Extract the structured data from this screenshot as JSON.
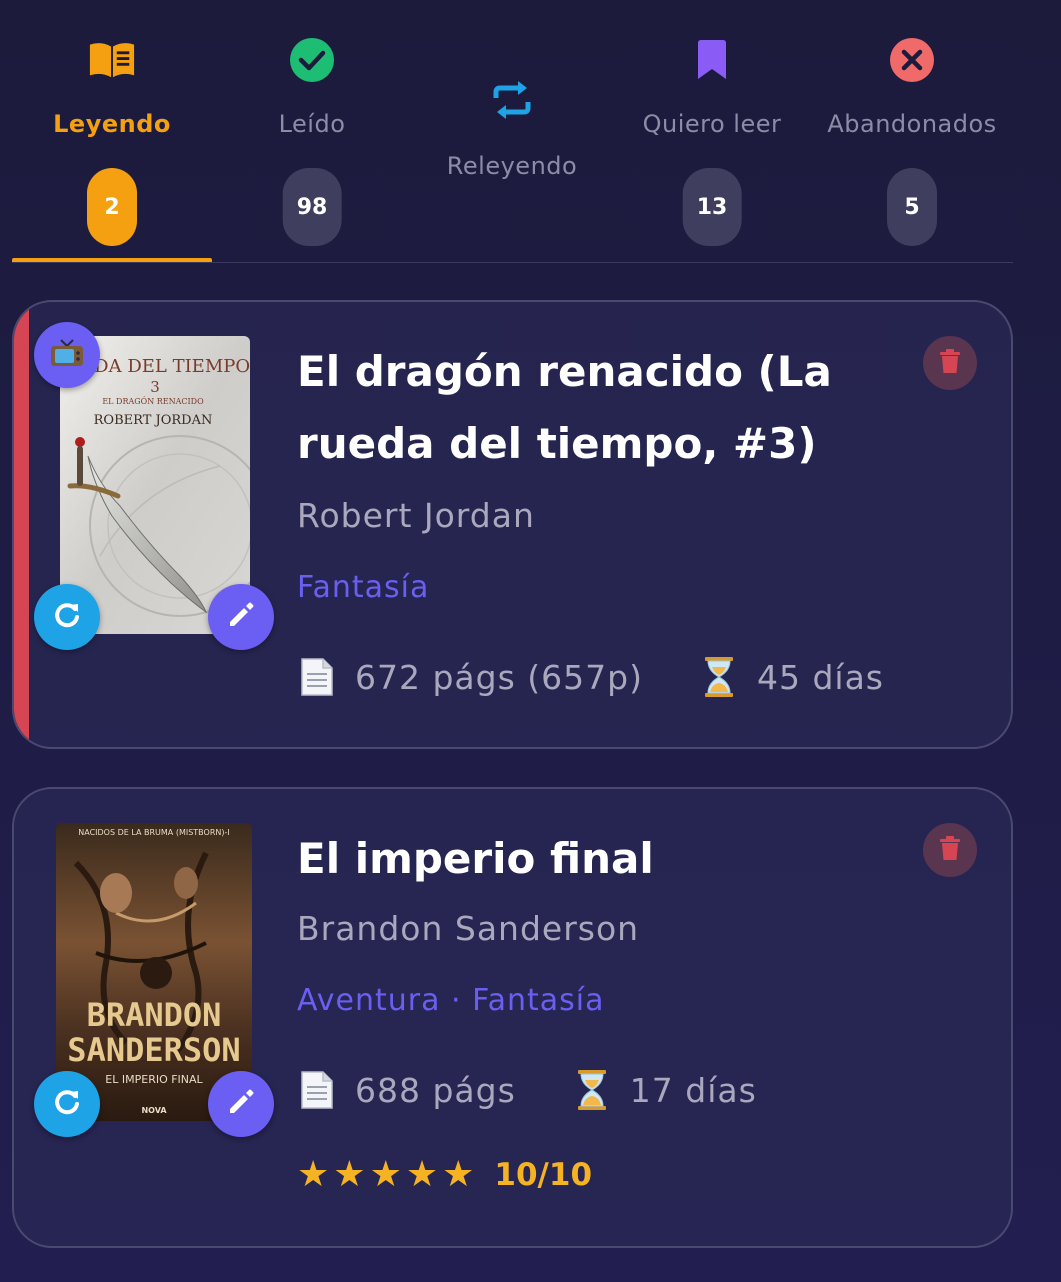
{
  "tabs": [
    {
      "label": "Leyendo",
      "count": "2",
      "icon": "book-open-icon",
      "active": true
    },
    {
      "label": "Leído",
      "count": "98",
      "icon": "check-circle-icon",
      "active": false
    },
    {
      "label": "Releyendo",
      "count": "",
      "icon": "repeat-icon",
      "active": false
    },
    {
      "label": "Quiero leer",
      "count": "13",
      "icon": "bookmark-icon",
      "active": false
    },
    {
      "label": "Abandonados",
      "count": "5",
      "icon": "x-circle-icon",
      "active": false
    }
  ],
  "books": [
    {
      "title": "El dragón renacido (La rueda del tiempo, #3)",
      "author": "Robert Jordan",
      "genres": "Fantasía",
      "pages": "672 págs (657p)",
      "days": "45 días",
      "cover": {
        "series_text": "UEDA DEL TIEMPO",
        "number": "3",
        "subtitle": "EL DRAGÓN RENACIDO",
        "author_text": "ROBERT JORDAN"
      }
    },
    {
      "title": "El imperio final",
      "author": "Brandon Sanderson",
      "genres": "Aventura · Fantasía",
      "pages": "688 págs",
      "days": "17 días",
      "rating": "10/10",
      "stars": 5,
      "cover": {
        "series_text": "NACIDOS DE LA BRUMA (MISTBORN)-I",
        "author_line1": "BRANDON",
        "author_line2": "SANDERSON",
        "subtitle": "EL IMPERIO FINAL",
        "publisher": "NOVA"
      }
    }
  ],
  "colors": {
    "accent": "#f5a011",
    "primary": "#6b5ef2",
    "refresh": "#1ea3e6",
    "in_progress_marker": "#d64553",
    "genre": "#6a5ff0",
    "rating": "#f5b324"
  }
}
